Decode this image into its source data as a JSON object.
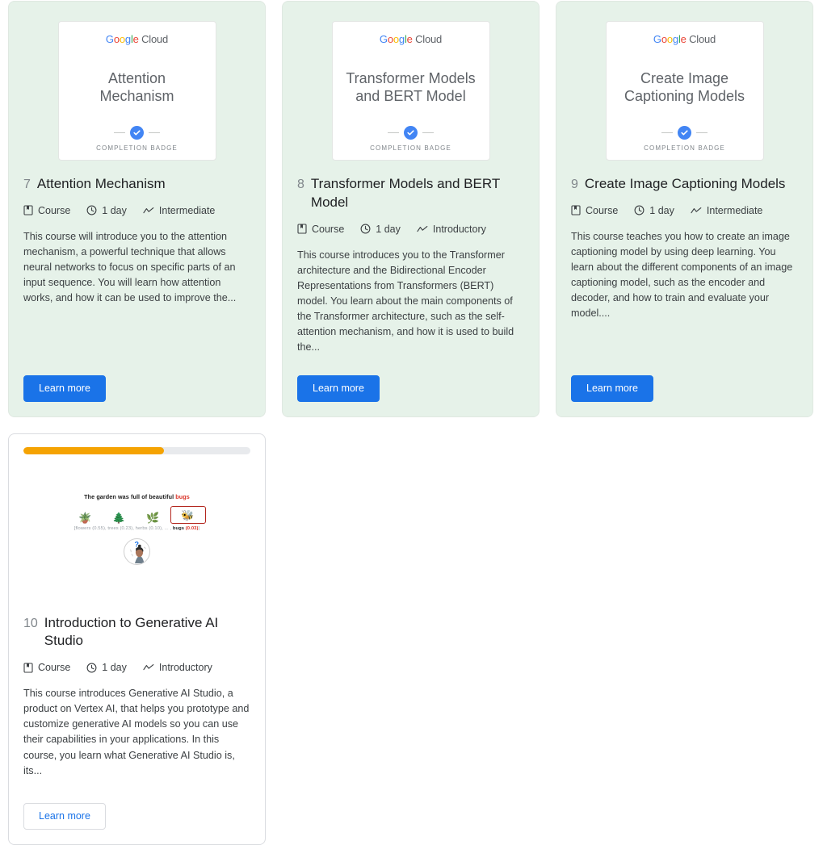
{
  "meta_icons": {
    "type": "book-icon",
    "duration": "clock-icon",
    "level": "trend-line-icon"
  },
  "badge": {
    "logo_prefix": "Google",
    "logo_suffix": "Cloud",
    "caption": "COMPLETION BADGE",
    "check_icon": "check-circle-icon"
  },
  "buttons": {
    "learn_more": "Learn more"
  },
  "cards": [
    {
      "number": "7",
      "title": "Attention Mechanism",
      "badge_title": "Attention Mechanism",
      "state": "completed",
      "meta": {
        "type": "Course",
        "duration": "1 day",
        "level": "Intermediate"
      },
      "description": "This course will introduce you to the attention mechanism, a powerful technique that allows neural networks to focus on specific parts of an input sequence. You will learn how attention works, and how it can be used to improve the...",
      "button_label": "Learn more",
      "button_style": "filled"
    },
    {
      "number": "8",
      "title": "Transformer Models and BERT Model",
      "badge_title": "Transformer Models and BERT Model",
      "state": "completed",
      "meta": {
        "type": "Course",
        "duration": "1 day",
        "level": "Introductory"
      },
      "description": "This course introduces you to the Transformer architecture and the Bidirectional Encoder Representations from Transformers (BERT) model. You learn about the main components of the Transformer architecture, such as the self-attention mechanism, and how it is used to build the...",
      "button_label": "Learn more",
      "button_style": "filled"
    },
    {
      "number": "9",
      "title": "Create Image Captioning Models",
      "badge_title": "Create Image Captioning Models",
      "state": "completed",
      "meta": {
        "type": "Course",
        "duration": "1 day",
        "level": "Intermediate"
      },
      "description": "This course teaches you how to create an image captioning model by using deep learning. You learn about the different components of an image captioning model, such as the encoder and decoder, and how to train and evaluate your model....",
      "button_label": "Learn more",
      "button_style": "filled"
    },
    {
      "number": "10",
      "title": "Introduction to Generative AI Studio",
      "state": "in-progress",
      "progress_percent": 62,
      "progress_color": "#f5a302",
      "thumbnail": {
        "caption_text": "The garden was full of beautiful ",
        "caption_highlight": "bugs",
        "tokens": [
          "flowers",
          "trees",
          "herbs",
          "bugs"
        ],
        "probs_text": "[flowers (0.55), trees (0.23), herbs (0.10), ... , ",
        "probs_boxed_label": "bugs",
        "probs_boxed_value": "(0.03)",
        "probs_tail": "]",
        "avatar_icon": "person-thinking-avatar"
      },
      "meta": {
        "type": "Course",
        "duration": "1 day",
        "level": "Introductory"
      },
      "description": "This course introduces Generative AI Studio, a product on Vertex AI, that helps you prototype and customize generative AI models so you can use their capabilities in your applications. In this course, you learn what Generative AI Studio is, its...",
      "button_label": "Learn more",
      "button_style": "outline"
    }
  ]
}
